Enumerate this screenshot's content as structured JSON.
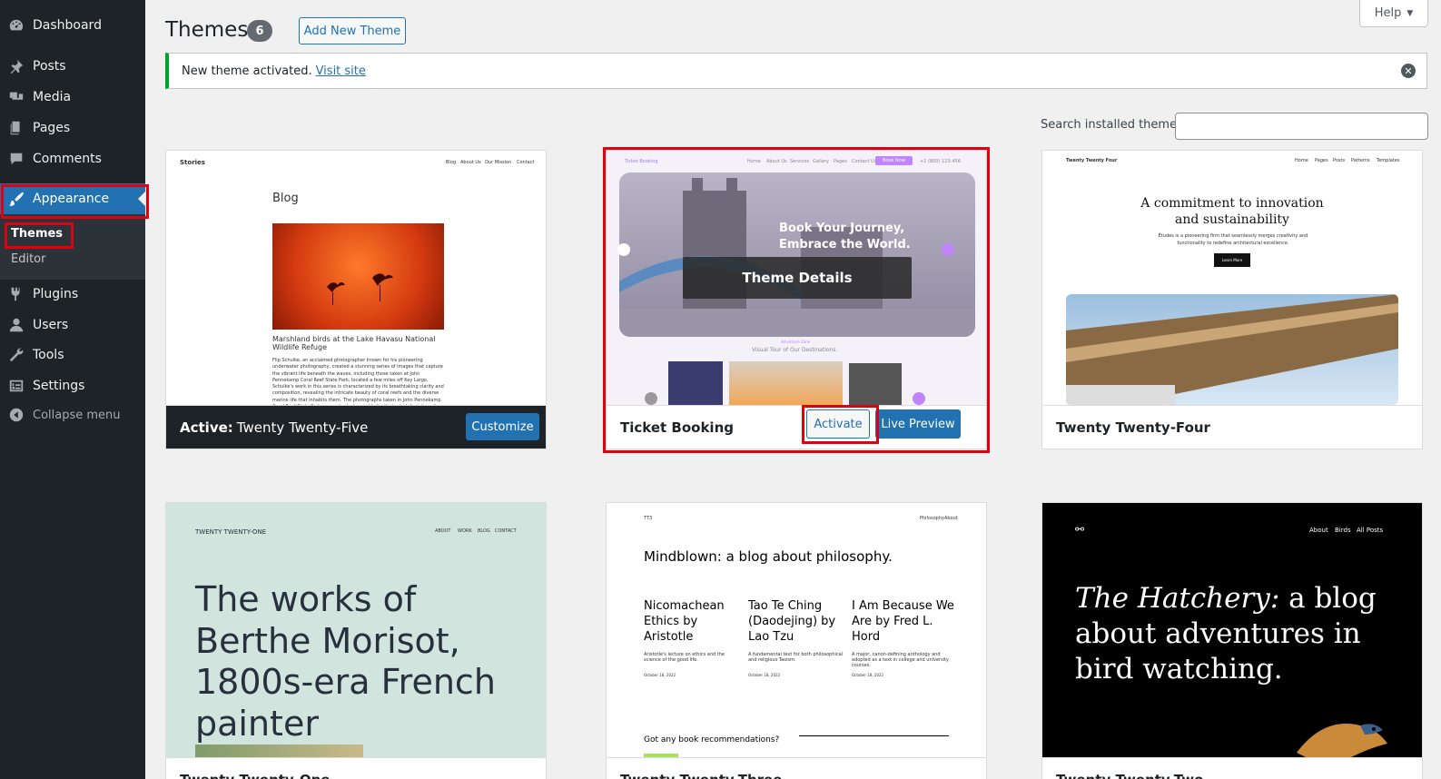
{
  "sidebar": {
    "items": [
      {
        "label": "Dashboard",
        "icon": "dashboard-icon"
      },
      {
        "label": "Posts",
        "icon": "pin-icon"
      },
      {
        "label": "Media",
        "icon": "media-icon"
      },
      {
        "label": "Pages",
        "icon": "pages-icon"
      },
      {
        "label": "Comments",
        "icon": "comments-icon"
      },
      {
        "label": "Appearance",
        "icon": "brush-icon"
      },
      {
        "label": "Plugins",
        "icon": "plugin-icon"
      },
      {
        "label": "Users",
        "icon": "user-icon"
      },
      {
        "label": "Tools",
        "icon": "wrench-icon"
      },
      {
        "label": "Settings",
        "icon": "settings-icon"
      }
    ],
    "submenu": [
      {
        "label": "Themes"
      },
      {
        "label": "Editor"
      }
    ],
    "collapse_label": "Collapse menu"
  },
  "header": {
    "title": "Themes",
    "count": "6",
    "add_new_label": "Add New Theme",
    "help_label": "Help"
  },
  "notice": {
    "message": "New theme activated.",
    "link_label": "Visit site"
  },
  "search": {
    "label": "Search installed themes",
    "value": ""
  },
  "themes": {
    "active": {
      "prefix": "Active:",
      "name": "Twenty Twenty-Five",
      "customize_label": "Customize",
      "preview": {
        "site": "Stories",
        "nav": [
          "Blog",
          "About Us",
          "Our Mission",
          "Contact"
        ],
        "heading": "Blog",
        "caption": "Marshland birds at the Lake Havasu National Wildlife Refuge",
        "body": "Flip Schulke, an acclaimed photographer known for his pioneering underwater photography, created a stunning series of images that capture the vibrant life beneath the waves, including those taken at John Pennekamp Coral Reef State Park, located a few miles off Key Largo. Schulke's work in this series is characterized by its breathtaking clarity and composition, revealing the intricate beauty of coral reefs and the diverse marine life that inhabits them. The photographs taken in John Pennekamp Coral Reef State Park are particularly notable for their vivid depiction of..."
      }
    },
    "ticket": {
      "name": "Ticket Booking",
      "details_label": "Theme Details",
      "activate_label": "Activate",
      "live_preview_label": "Live Preview",
      "preview": {
        "site": "Ticket Booking",
        "nav": [
          "Home",
          "About Us",
          "Services",
          "Gallery",
          "Pages",
          "Contact Us"
        ],
        "cta": "Book Now",
        "phone": "+1 (800) 123-456",
        "hero_line1": "Book Your Journey,",
        "hero_line2": "Embrace the World.",
        "sub_kicker": "Adventure Zone",
        "sub_title": "Visual Tour of Our Destinations."
      }
    },
    "tt4": {
      "name": "Twenty Twenty-Four",
      "preview": {
        "site": "Twenty Twenty Four",
        "nav": [
          "Home",
          "Pages",
          "Posts",
          "Patterns",
          "Templates"
        ],
        "heading1": "A commitment to innovation",
        "heading2": "and sustainability",
        "body": "Études is a pioneering firm that seamlessly merges creativity and functionality to redefine architectural excellence.",
        "button": "Learn More"
      }
    },
    "tt1": {
      "name": "Twenty Twenty-One",
      "preview": {
        "site": "TWENTY TWENTY-ONE",
        "nav": [
          "ABOUT",
          "WORK",
          "BLOG",
          "CONTACT"
        ],
        "heading": "The works of Berthe Morisot, 1800s-era French painter"
      }
    },
    "tt3": {
      "name": "Twenty Twenty-Three",
      "preview": {
        "site": "TT3",
        "nav": [
          "Philosophy",
          "About"
        ],
        "heading": "Mindblown: a blog about philosophy.",
        "posts": [
          {
            "title": "Nicomachean Ethics by Aristotle",
            "excerpt": "Aristotle's lecture on ethics and the science of the good life.",
            "date": "October 18, 2022"
          },
          {
            "title": "Tao Te Ching (Daodejing) by Lao Tzu",
            "excerpt": "A fundamental text for both philosophical and religious Taoism.",
            "date": "October 18, 2022"
          },
          {
            "title": "I Am Because We Are by Fred L. Hord",
            "excerpt": "A major, canon-defining anthology and adopted as a text in college and university courses.",
            "date": "October 18, 2022"
          }
        ],
        "footer_q": "Got any book recommendations?"
      }
    },
    "tt2": {
      "name": "Twenty Twenty-Two",
      "preview": {
        "nav": [
          "About",
          "Birds",
          "All Posts"
        ],
        "heading_italic": "The Hatchery:",
        "heading_rest": "a blog about adventures in bird watching."
      }
    }
  },
  "colors": {
    "accent": "#2271b1",
    "sidebar_bg": "#1d2327",
    "notice_success": "#00a32a",
    "highlight": "#e00010"
  }
}
